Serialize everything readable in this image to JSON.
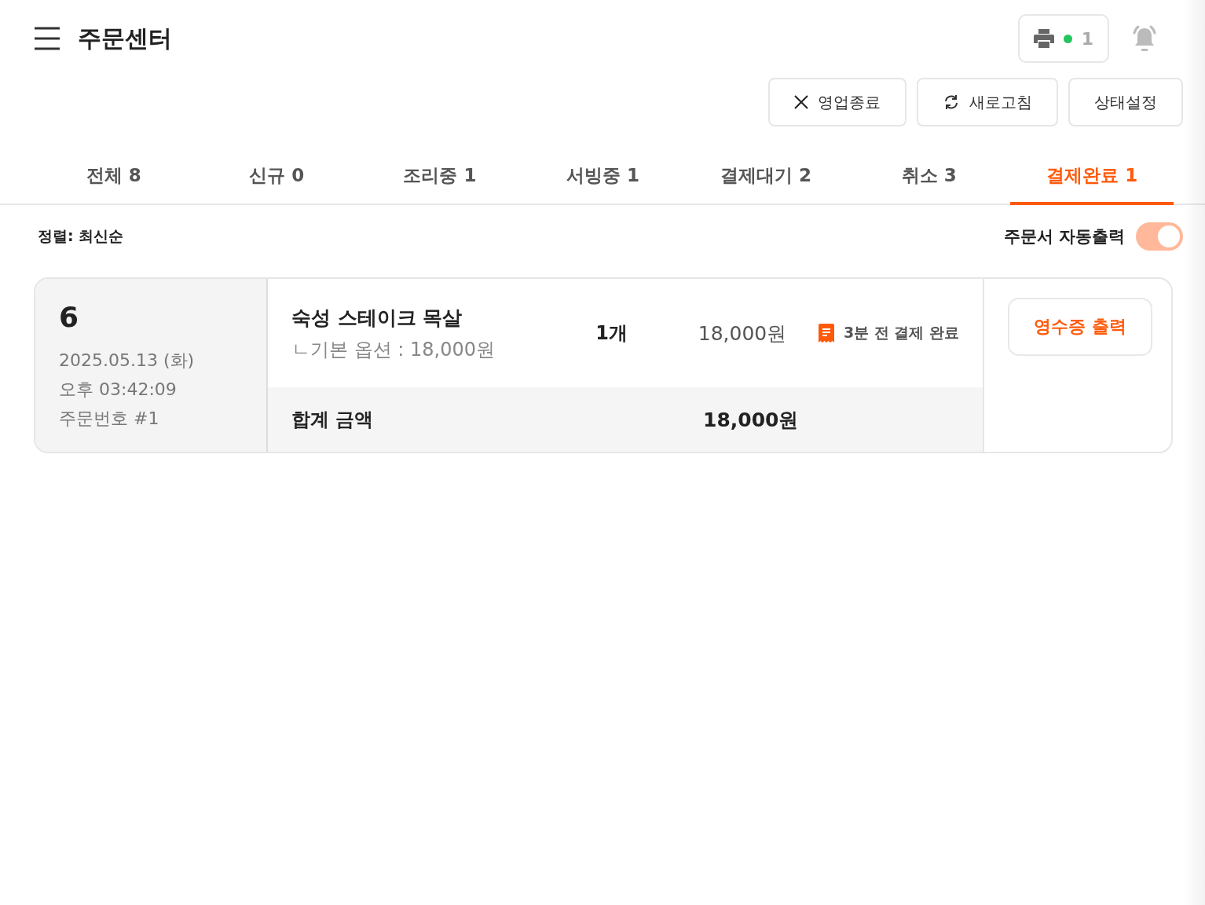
{
  "header": {
    "title": "주문센터",
    "printer_count": "1",
    "printer_online": true
  },
  "actions": [
    {
      "label": "영업종료",
      "kind": "close"
    },
    {
      "label": "새로고침",
      "kind": "refresh"
    },
    {
      "label": "상태설정",
      "kind": "plain"
    }
  ],
  "tabs": [
    {
      "label": "전체 8",
      "selected": false
    },
    {
      "label": "신규 0",
      "selected": false
    },
    {
      "label": "조리중 1",
      "selected": false
    },
    {
      "label": "서빙중 1",
      "selected": false
    },
    {
      "label": "결제대기 2",
      "selected": false
    },
    {
      "label": "취소 3",
      "selected": false
    },
    {
      "label": "결제완료 1",
      "selected": true
    }
  ],
  "sort_label": "정렬: 최신순",
  "auto_print": {
    "label": "주문서 자동출력",
    "on": true
  },
  "orders": [
    {
      "number": "6",
      "date": "2025.05.13 (화)",
      "time": "오후 03:42:09",
      "order_no": "주문번호 #1",
      "items": [
        {
          "name": "숙성 스테이크 목살",
          "option": "ㄴ기본 옵션 : 18,000원",
          "qty": "1개",
          "price": "18,000원"
        }
      ],
      "status": "3분 전 결제 완료",
      "total_label": "합계 금액",
      "total": "18,000원",
      "receipt_button": "영수증 출력"
    }
  ]
}
